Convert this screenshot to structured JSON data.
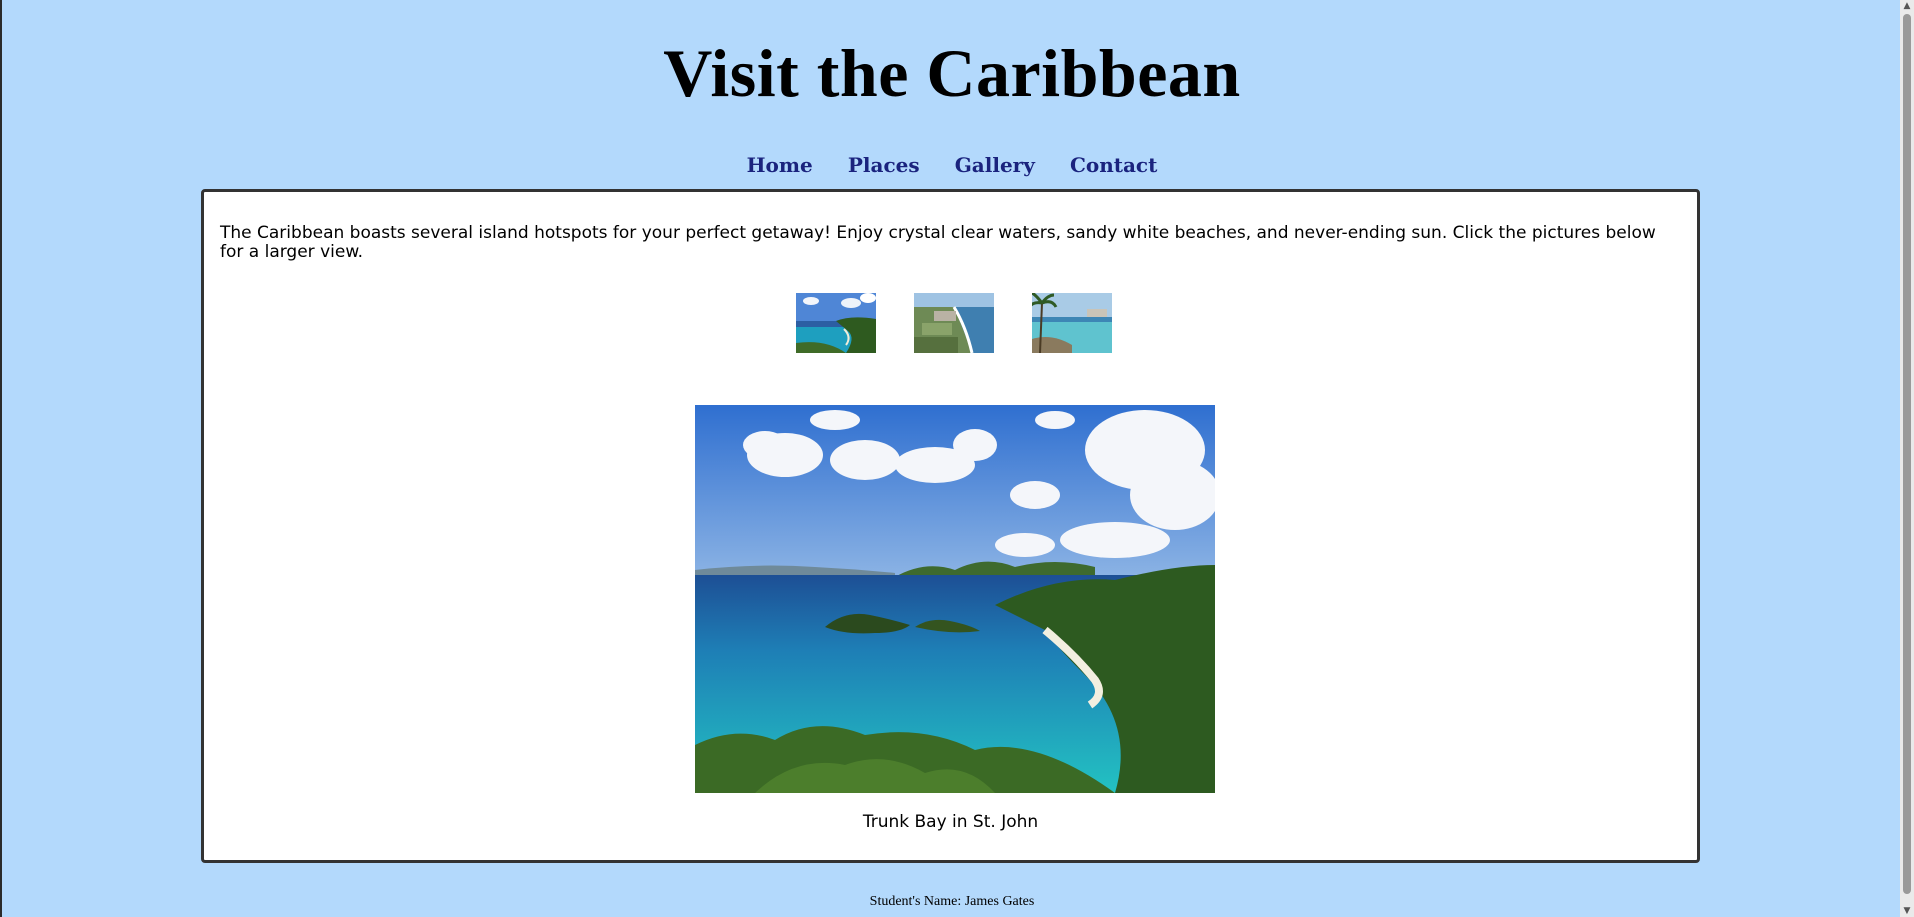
{
  "header": {
    "title": "Visit the Caribbean"
  },
  "nav": {
    "items": [
      {
        "label": "Home"
      },
      {
        "label": "Places"
      },
      {
        "label": "Gallery"
      },
      {
        "label": "Contact"
      }
    ]
  },
  "main": {
    "intro": "The Caribbean boasts several island hotspots for your perfect getaway! Enjoy crystal clear waters, sandy white beaches, and never-ending sun. Click the pictures below for a larger view.",
    "thumbnails": [
      {
        "image": "trunk-bay-bay-view"
      },
      {
        "image": "coastline-town-view"
      },
      {
        "image": "beach-with-palm-view"
      }
    ],
    "main_image": {
      "image": "trunk-bay-large-photo"
    },
    "caption": "Trunk Bay in St. John"
  },
  "footer": {
    "text": "Student's Name: James Gates"
  },
  "colors": {
    "page_background": "#b3d9fc",
    "nav_link": "#1a237e",
    "content_background": "#ffffff",
    "content_border": "#333333"
  }
}
